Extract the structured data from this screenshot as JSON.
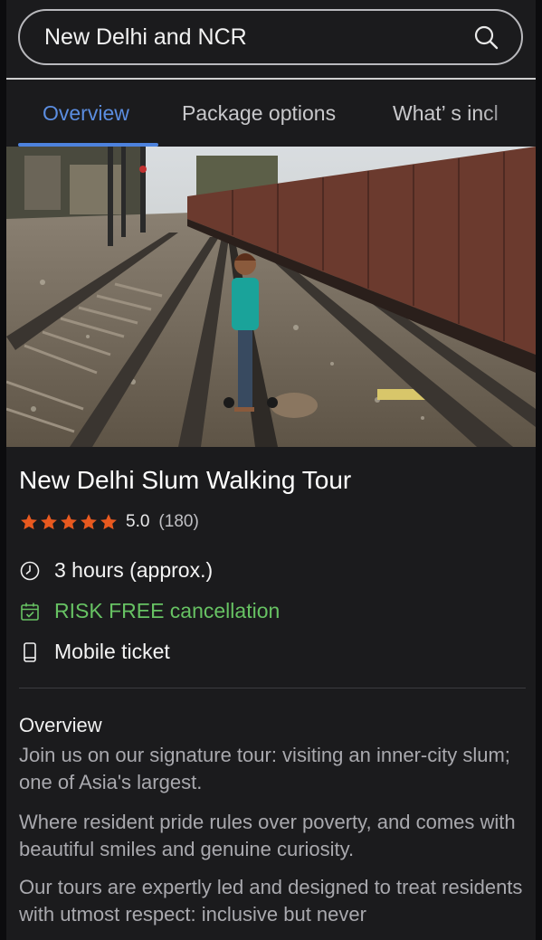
{
  "search": {
    "query": "New Delhi and NCR",
    "icon": "search-icon"
  },
  "tabs": [
    {
      "label": "Overview",
      "active": true
    },
    {
      "label": "Package options",
      "active": false
    },
    {
      "label": "What’ s incl",
      "active": false
    }
  ],
  "colors": {
    "background": "#1b1b1d",
    "accent_tab": "#5b8de0",
    "star": "#e8591f",
    "cancellation_green": "#67c263",
    "body_text": "#a9a9ae"
  },
  "photo": {
    "description_icon": "tour-photo"
  },
  "tour": {
    "title": "New Delhi Slum Walking Tour",
    "rating": "5.0",
    "reviews": "(180)",
    "stars": 5
  },
  "features": [
    {
      "icon": "clock-icon",
      "text": "3 hours (approx.)"
    },
    {
      "icon": "calendar-check-icon",
      "text": "RISK FREE cancellation"
    },
    {
      "icon": "mobile-phone-icon",
      "text": "Mobile ticket"
    }
  ],
  "overview": {
    "heading": "Overview",
    "paragraphs": [
      "Join us on our signature tour: visiting an inner-city slum; one of Asia's largest.",
      "Where resident pride rules over poverty, and comes with beautiful smiles and genuine curiosity.",
      "Our tours are expertly led and designed to treat residents with utmost respect: inclusive but never"
    ]
  }
}
